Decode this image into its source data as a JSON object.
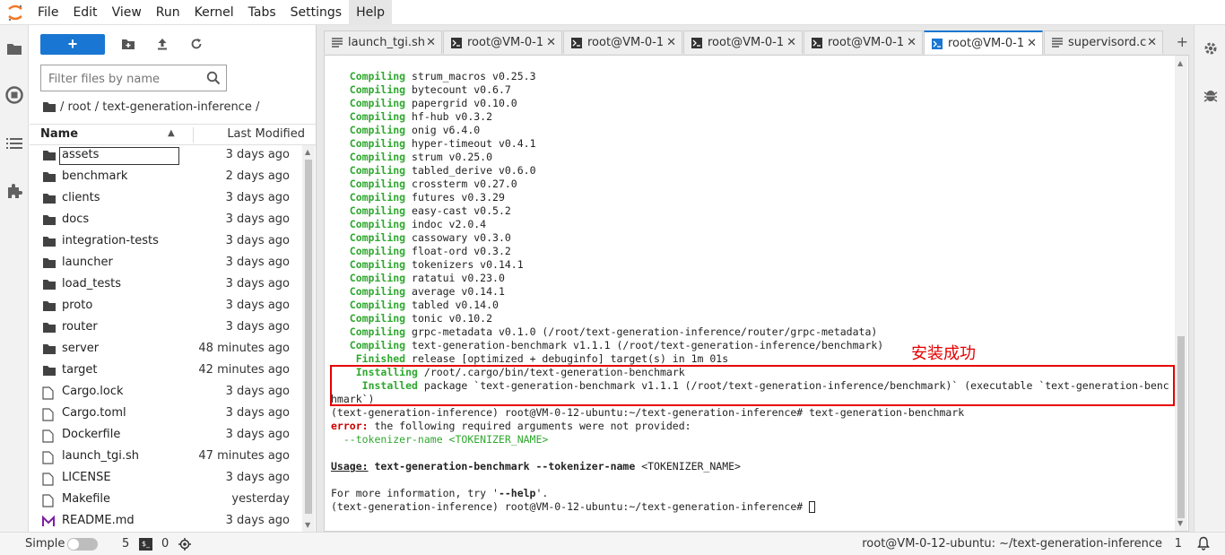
{
  "menubar": {
    "items": [
      "File",
      "Edit",
      "View",
      "Run",
      "Kernel",
      "Tabs",
      "Settings",
      "Help"
    ],
    "active_item": "Help"
  },
  "filebrowser": {
    "new_button_label": "+",
    "search_placeholder": "Filter files by name",
    "breadcrumb": "/ root / text-generation-inference /",
    "header_name": "Name",
    "header_modified": "Last Modified",
    "files": [
      {
        "name": "assets",
        "modified": "3 days ago",
        "type": "folder",
        "selected": true
      },
      {
        "name": "benchmark",
        "modified": "2 days ago",
        "type": "folder"
      },
      {
        "name": "clients",
        "modified": "3 days ago",
        "type": "folder"
      },
      {
        "name": "docs",
        "modified": "3 days ago",
        "type": "folder"
      },
      {
        "name": "integration-tests",
        "modified": "3 days ago",
        "type": "folder"
      },
      {
        "name": "launcher",
        "modified": "3 days ago",
        "type": "folder"
      },
      {
        "name": "load_tests",
        "modified": "3 days ago",
        "type": "folder"
      },
      {
        "name": "proto",
        "modified": "3 days ago",
        "type": "folder"
      },
      {
        "name": "router",
        "modified": "3 days ago",
        "type": "folder"
      },
      {
        "name": "server",
        "modified": "48 minutes ago",
        "type": "folder"
      },
      {
        "name": "target",
        "modified": "42 minutes ago",
        "type": "folder"
      },
      {
        "name": "Cargo.lock",
        "modified": "3 days ago",
        "type": "file"
      },
      {
        "name": "Cargo.toml",
        "modified": "3 days ago",
        "type": "file"
      },
      {
        "name": "Dockerfile",
        "modified": "3 days ago",
        "type": "file"
      },
      {
        "name": "launch_tgi.sh",
        "modified": "47 minutes ago",
        "type": "file"
      },
      {
        "name": "LICENSE",
        "modified": "3 days ago",
        "type": "file"
      },
      {
        "name": "Makefile",
        "modified": "yesterday",
        "type": "file"
      },
      {
        "name": "README.md",
        "modified": "3 days ago",
        "type": "markdown"
      }
    ]
  },
  "tabs": [
    {
      "label": "launch_tgi.sh",
      "icon": "file-icon"
    },
    {
      "label": "root@VM-0-1",
      "icon": "terminal-icon"
    },
    {
      "label": "root@VM-0-1",
      "icon": "terminal-icon"
    },
    {
      "label": "root@VM-0-1",
      "icon": "terminal-icon"
    },
    {
      "label": "root@VM-0-1",
      "icon": "terminal-icon"
    },
    {
      "label": "root@VM-0-1",
      "icon": "terminal-icon",
      "active": true
    },
    {
      "label": "supervisord.c",
      "icon": "file-icon"
    }
  ],
  "terminal": {
    "annotation": "安装成功",
    "lines": [
      {
        "kw": "Compiling",
        "rest": " strum_macros v0.25.3"
      },
      {
        "kw": "Compiling",
        "rest": " bytecount v0.6.7"
      },
      {
        "kw": "Compiling",
        "rest": " papergrid v0.10.0"
      },
      {
        "kw": "Compiling",
        "rest": " hf-hub v0.3.2"
      },
      {
        "kw": "Compiling",
        "rest": " onig v6.4.0"
      },
      {
        "kw": "Compiling",
        "rest": " hyper-timeout v0.4.1"
      },
      {
        "kw": "Compiling",
        "rest": " strum v0.25.0"
      },
      {
        "kw": "Compiling",
        "rest": " tabled_derive v0.6.0"
      },
      {
        "kw": "Compiling",
        "rest": " crossterm v0.27.0"
      },
      {
        "kw": "Compiling",
        "rest": " futures v0.3.29"
      },
      {
        "kw": "Compiling",
        "rest": " easy-cast v0.5.2"
      },
      {
        "kw": "Compiling",
        "rest": " indoc v2.0.4"
      },
      {
        "kw": "Compiling",
        "rest": " cassowary v0.3.0"
      },
      {
        "kw": "Compiling",
        "rest": " float-ord v0.3.2"
      },
      {
        "kw": "Compiling",
        "rest": " tokenizers v0.14.1"
      },
      {
        "kw": "Compiling",
        "rest": " ratatui v0.23.0"
      },
      {
        "kw": "Compiling",
        "rest": " average v0.14.1"
      },
      {
        "kw": "Compiling",
        "rest": " tabled v0.14.0"
      },
      {
        "kw": "Compiling",
        "rest": " tonic v0.10.2"
      },
      {
        "kw": "Compiling",
        "rest": " grpc-metadata v0.1.0 (/root/text-generation-inference/router/grpc-metadata)"
      },
      {
        "kw": "Compiling",
        "rest": " text-generation-benchmark v1.1.1 (/root/text-generation-inference/benchmark)"
      },
      {
        "kw": " Finished",
        "rest": " release [optimized + debuginfo] target(s) in 1m 01s"
      },
      {
        "kw": "Installing",
        "rest": " /root/.cargo/bin/text-generation-benchmark",
        "indent": " "
      },
      {
        "kw": " Installed",
        "rest": " package `text-generation-benchmark v1.1.1 (/root/text-generation-inference/benchmark)` (executable `text-generation-benc",
        "indent": " "
      }
    ],
    "wrap_line": "hmark`)",
    "prompt_line": "(text-generation-inference) root@VM-0-12-ubuntu:~/text-generation-inference# text-generation-benchmark",
    "error_kw": "error:",
    "error_rest": " the following required arguments were not provided:",
    "error_arg": "  --tokenizer-name <TOKENIZER_NAME>",
    "usage_kw": "Usage:",
    "usage_cmd": " text-generation-benchmark --tokenizer-name",
    "usage_arg": " <TOKENIZER_NAME>",
    "help_pre": "For more information, try '",
    "help_kw": "--help",
    "help_post": "'.",
    "final_prompt": "(text-generation-inference) root@VM-0-12-ubuntu:~/text-generation-inference# "
  },
  "statusbar": {
    "simple_label": "Simple",
    "count1": "5",
    "count2": "0",
    "right_text": "root@VM-0-12-ubuntu: ~/text-generation-inference",
    "right_count": "1"
  },
  "colors": {
    "accent": "#1976d2",
    "terminal_green": "#2fa82f",
    "error_red": "#cc0000",
    "annotation_red": "#e60000"
  }
}
